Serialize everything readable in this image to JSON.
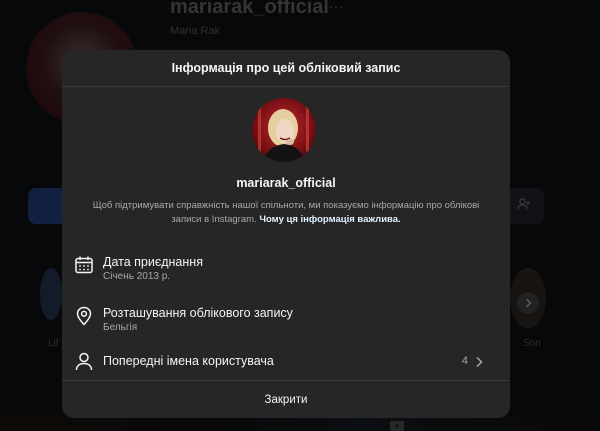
{
  "background": {
    "username": "mariarak_official",
    "more": "···",
    "full_name": "Maria Rak",
    "highlight_left_label": "Lif",
    "highlight_right_label": "Son"
  },
  "modal": {
    "title": "Інформація про цей обліковий запис",
    "username": "mariarak_official",
    "description": "Щоб підтримувати справжність нашої спільноти, ми показуємо інформацію про облікові записи в Instagram.",
    "learn_more": "Чому ця інформація важлива.",
    "date_joined": {
      "title": "Дата приєднання",
      "value": "Січень 2013 р.",
      "icon": "calendar-icon"
    },
    "account_location": {
      "title": "Розташування облікового запису",
      "value": "Бельгія",
      "icon": "location-pin-icon"
    },
    "former_usernames": {
      "title": "Попередні імена користувача",
      "count": "4",
      "icon": "person-icon"
    },
    "close_label": "Закрити"
  },
  "colors": {
    "modal_background": "#262626",
    "text_primary": "#f5f5f5",
    "text_secondary": "#a8a8a8",
    "link": "#e0f1ff"
  }
}
